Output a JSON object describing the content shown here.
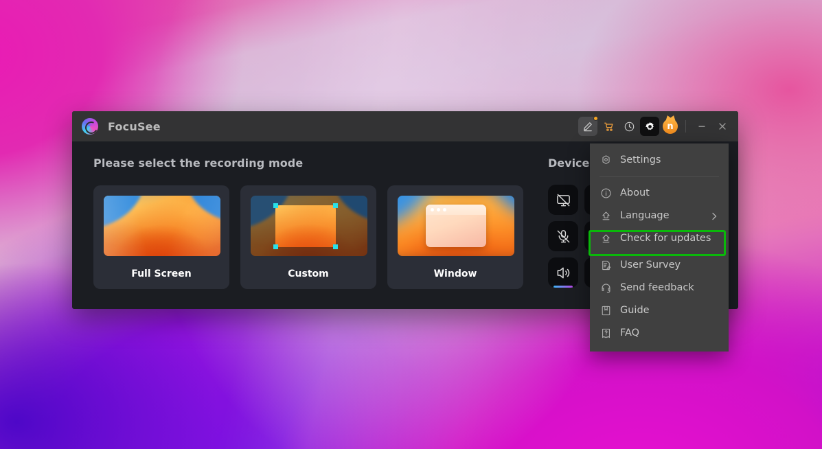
{
  "app": {
    "title": "FocuSee",
    "logo_icon": "focusee-logo-icon"
  },
  "titlebar": {
    "buttons": [
      {
        "name": "edit-button",
        "icon": "pen-edit-icon",
        "badge": true
      },
      {
        "name": "store-button",
        "icon": "shopping-cart-icon",
        "badge": false
      },
      {
        "name": "history-button",
        "icon": "clock-history-icon",
        "badge": false
      },
      {
        "name": "settings-button",
        "icon": "gear-icon",
        "badge": false
      },
      {
        "name": "promo-button",
        "icon": "n-crown-badge-icon",
        "label": "n",
        "badge": false
      }
    ],
    "window_controls": [
      {
        "name": "minimize-button",
        "icon": "minimize-icon"
      },
      {
        "name": "close-button",
        "icon": "close-icon"
      }
    ]
  },
  "recording": {
    "heading": "Please select the recording mode",
    "modes": [
      {
        "label": "Full Screen",
        "thumb": "fullscreen-wallpaper-thumb",
        "selected": false
      },
      {
        "label": "Custom",
        "thumb": "custom-region-thumb",
        "selected": false
      },
      {
        "label": "Window",
        "thumb": "window-capture-thumb",
        "selected": false
      }
    ]
  },
  "device": {
    "heading": "Device Settings",
    "heading_visible": "Device S",
    "rows": [
      {
        "name": "camera",
        "icon": "camera-off-icon",
        "enabled": false,
        "value": ""
      },
      {
        "name": "microphone",
        "icon": "microphone-off-icon",
        "enabled": false,
        "value": ""
      },
      {
        "name": "speaker",
        "icon": "speaker-on-icon",
        "enabled": true,
        "value": ""
      }
    ]
  },
  "menu": {
    "items": [
      {
        "label": "Settings",
        "icon": "settings-hex-icon",
        "chevron": false,
        "highlighted": false
      },
      {
        "type": "separator"
      },
      {
        "label": "About",
        "icon": "info-circle-icon",
        "chevron": false,
        "highlighted": false
      },
      {
        "label": "Language",
        "icon": "arrow-up-home-icon",
        "chevron": true,
        "highlighted": false
      },
      {
        "label": "Check for updates",
        "icon": "arrow-up-home-icon",
        "chevron": false,
        "highlighted": true
      },
      {
        "type": "gap"
      },
      {
        "label": "User Survey",
        "icon": "survey-document-icon",
        "chevron": false,
        "highlighted": false
      },
      {
        "label": "Send feedback",
        "icon": "headset-icon",
        "chevron": false,
        "highlighted": false
      },
      {
        "label": "Guide",
        "icon": "book-bookmark-icon",
        "chevron": false,
        "highlighted": false
      },
      {
        "label": "FAQ",
        "icon": "faq-question-icon",
        "chevron": false,
        "highlighted": false
      }
    ]
  },
  "colors": {
    "highlight_ring": "#0ab80a",
    "menu_bg": "#404040",
    "window_bg": "#1b1d22",
    "titlebar_bg": "#333334",
    "card_bg": "#2b2e37",
    "accent_orange": "#f0a03c",
    "selection_cyan": "#29e0e8",
    "speaker_gradient_start": "#3fb6f5",
    "speaker_gradient_end": "#b44ae8"
  }
}
